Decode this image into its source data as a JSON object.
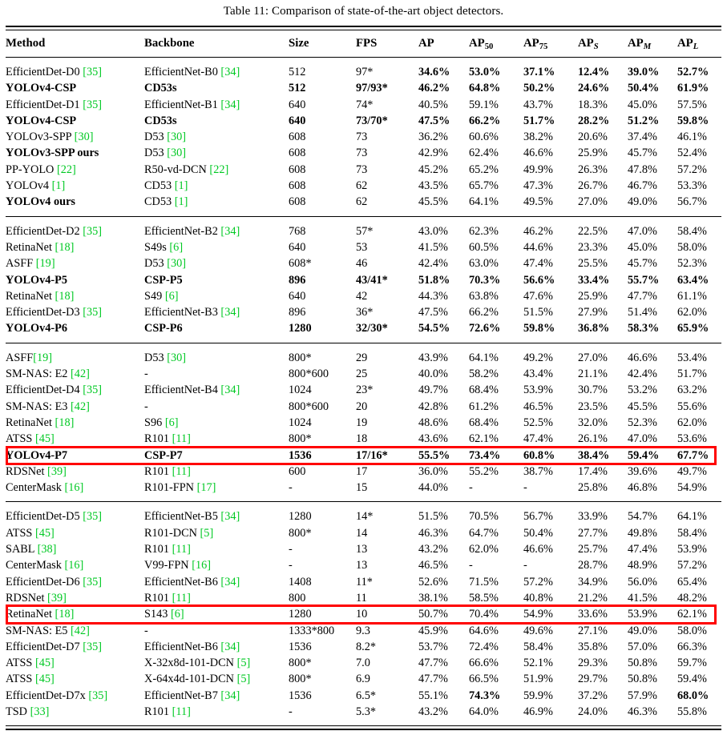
{
  "caption": "Table 11: Comparison of state-of-the-art object detectors.",
  "colors": {
    "citation_green": "#00C923",
    "highlight_red": "#FF0000"
  },
  "columns": [
    {
      "key": "method",
      "label": "Method"
    },
    {
      "key": "backbone",
      "label": "Backbone"
    },
    {
      "key": "size",
      "label": "Size"
    },
    {
      "key": "fps",
      "label": "FPS"
    },
    {
      "key": "ap",
      "label": "AP"
    },
    {
      "key": "ap50",
      "label": "AP",
      "sub": "50"
    },
    {
      "key": "ap75",
      "label": "AP",
      "sub": "75"
    },
    {
      "key": "aps",
      "label": "AP",
      "sub": "S"
    },
    {
      "key": "apm",
      "label": "AP",
      "sub": "M"
    },
    {
      "key": "apl",
      "label": "AP",
      "sub": "L"
    }
  ],
  "sections": [
    {
      "rows": [
        {
          "bold": false,
          "method": "EfficientDet-D0",
          "method_cite": "35",
          "backbone": "EfficientNet-B0",
          "backbone_cite": "34",
          "size": "512",
          "fps": "97*",
          "ap": "34.6%",
          "ap50": "53.0%",
          "ap75": "37.1%",
          "aps": "12.4%",
          "apm": "39.0%",
          "apl": "52.7%",
          "bold_nums": true
        },
        {
          "bold": true,
          "method": "YOLOv4-CSP",
          "method_cite": "",
          "backbone": "CD53s",
          "backbone_cite": "",
          "size": "512",
          "fps": "97/93*",
          "ap": "46.2%",
          "ap50": "64.8%",
          "ap75": "50.2%",
          "aps": "24.6%",
          "apm": "50.4%",
          "apl": "61.9%",
          "bold_nums": true
        },
        {
          "bold": false,
          "method": "EfficientDet-D1",
          "method_cite": "35",
          "backbone": "EfficientNet-B1",
          "backbone_cite": "34",
          "size": "640",
          "fps": "74*",
          "ap": "40.5%",
          "ap50": "59.1%",
          "ap75": "43.7%",
          "aps": "18.3%",
          "apm": "45.0%",
          "apl": "57.5%",
          "bold_nums": false
        },
        {
          "bold": true,
          "method": "YOLOv4-CSP",
          "method_cite": "",
          "backbone": "CD53s",
          "backbone_cite": "",
          "size": "640",
          "fps": "73/70*",
          "ap": "47.5%",
          "ap50": "66.2%",
          "ap75": "51.7%",
          "aps": "28.2%",
          "apm": "51.2%",
          "apl": "59.8%",
          "bold_nums": true
        },
        {
          "bold": false,
          "method": "YOLOv3-SPP",
          "method_cite": "30",
          "backbone": "D53",
          "backbone_cite": "30",
          "size": "608",
          "fps": "73",
          "ap": "36.2%",
          "ap50": "60.6%",
          "ap75": "38.2%",
          "aps": "20.6%",
          "apm": "37.4%",
          "apl": "46.1%",
          "bold_nums": false
        },
        {
          "bold": true,
          "method": "YOLOv3-SPP ours",
          "method_cite": "",
          "backbone": "D53",
          "backbone_cite": "30",
          "size": "608",
          "fps": "73",
          "ap": "42.9%",
          "ap50": "62.4%",
          "ap75": "46.6%",
          "aps": "25.9%",
          "apm": "45.7%",
          "apl": "52.4%",
          "bold_nums": false,
          "bold_method_only": true
        },
        {
          "bold": false,
          "method": "PP-YOLO",
          "method_cite": "22",
          "backbone": "R50-vd-DCN",
          "backbone_cite": "22",
          "size": "608",
          "fps": "73",
          "ap": "45.2%",
          "ap50": "65.2%",
          "ap75": "49.9%",
          "aps": "26.3%",
          "apm": "47.8%",
          "apl": "57.2%",
          "bold_nums": false
        },
        {
          "bold": false,
          "method": "YOLOv4",
          "method_cite": "1",
          "backbone": "CD53",
          "backbone_cite": "1",
          "size": "608",
          "fps": "62",
          "ap": "43.5%",
          "ap50": "65.7%",
          "ap75": "47.3%",
          "aps": "26.7%",
          "apm": "46.7%",
          "apl": "53.3%",
          "bold_nums": false
        },
        {
          "bold": true,
          "method": "YOLOv4 ours",
          "method_cite": "",
          "backbone": "CD53",
          "backbone_cite": "1",
          "size": "608",
          "fps": "62",
          "ap": "45.5%",
          "ap50": "64.1%",
          "ap75": "49.5%",
          "aps": "27.0%",
          "apm": "49.0%",
          "apl": "56.7%",
          "bold_nums": false,
          "bold_method_only": true
        }
      ]
    },
    {
      "rows": [
        {
          "bold": false,
          "method": "EfficientDet-D2",
          "method_cite": "35",
          "backbone": "EfficientNet-B2",
          "backbone_cite": "34",
          "size": "768",
          "fps": "57*",
          "ap": "43.0%",
          "ap50": "62.3%",
          "ap75": "46.2%",
          "aps": "22.5%",
          "apm": "47.0%",
          "apl": "58.4%",
          "bold_nums": false
        },
        {
          "bold": false,
          "method": "RetinaNet",
          "method_cite": "18",
          "backbone": "S49s",
          "backbone_cite": "6",
          "size": "640",
          "fps": "53",
          "ap": "41.5%",
          "ap50": "60.5%",
          "ap75": "44.6%",
          "aps": "23.3%",
          "apm": "45.0%",
          "apl": "58.0%",
          "bold_nums": false
        },
        {
          "bold": false,
          "method": "ASFF",
          "method_cite": "19",
          "backbone": "D53",
          "backbone_cite": "30",
          "size": "608*",
          "fps": "46",
          "ap": "42.4%",
          "ap50": "63.0%",
          "ap75": "47.4%",
          "aps": "25.5%",
          "apm": "45.7%",
          "apl": "52.3%",
          "bold_nums": false
        },
        {
          "bold": true,
          "method": "YOLOv4-P5",
          "method_cite": "",
          "backbone": "CSP-P5",
          "backbone_cite": "",
          "size": "896",
          "fps": "43/41*",
          "ap": "51.8%",
          "ap50": "70.3%",
          "ap75": "56.6%",
          "aps": "33.4%",
          "apm": "55.7%",
          "apl": "63.4%",
          "bold_nums": true
        },
        {
          "bold": false,
          "method": "RetinaNet",
          "method_cite": "18",
          "backbone": "S49",
          "backbone_cite": "6",
          "size": "640",
          "fps": "42",
          "ap": "44.3%",
          "ap50": "63.8%",
          "ap75": "47.6%",
          "aps": "25.9%",
          "apm": "47.7%",
          "apl": "61.1%",
          "bold_nums": false
        },
        {
          "bold": false,
          "method": "EfficientDet-D3",
          "method_cite": "35",
          "backbone": "EfficientNet-B3",
          "backbone_cite": "34",
          "size": "896",
          "fps": "36*",
          "ap": "47.5%",
          "ap50": "66.2%",
          "ap75": "51.5%",
          "aps": "27.9%",
          "apm": "51.4%",
          "apl": "62.0%",
          "bold_nums": false
        },
        {
          "bold": true,
          "method": "YOLOv4-P6",
          "method_cite": "",
          "backbone": "CSP-P6",
          "backbone_cite": "",
          "size": "1280",
          "fps": "32/30*",
          "ap": "54.5%",
          "ap50": "72.6%",
          "ap75": "59.8%",
          "aps": "36.8%",
          "apm": "58.3%",
          "apl": "65.9%",
          "bold_nums": true
        }
      ]
    },
    {
      "rows": [
        {
          "bold": false,
          "method": "ASFF",
          "method_cite": "19",
          "method_nospace": true,
          "backbone": "D53",
          "backbone_cite": "30",
          "size": "800*",
          "fps": "29",
          "ap": "43.9%",
          "ap50": "64.1%",
          "ap75": "49.2%",
          "aps": "27.0%",
          "apm": "46.6%",
          "apl": "53.4%",
          "bold_nums": false
        },
        {
          "bold": false,
          "method": "SM-NAS: E2",
          "method_cite": "42",
          "backbone": "-",
          "backbone_cite": "",
          "size": "800*600",
          "fps": "25",
          "ap": "40.0%",
          "ap50": "58.2%",
          "ap75": "43.4%",
          "aps": "21.1%",
          "apm": "42.4%",
          "apl": "51.7%",
          "bold_nums": false
        },
        {
          "bold": false,
          "method": "EfficientDet-D4",
          "method_cite": "35",
          "backbone": "EfficientNet-B4",
          "backbone_cite": "34",
          "size": "1024",
          "fps": "23*",
          "ap": "49.7%",
          "ap50": "68.4%",
          "ap75": "53.9%",
          "aps": "30.7%",
          "apm": "53.2%",
          "apl": "63.2%",
          "bold_nums": false
        },
        {
          "bold": false,
          "method": "SM-NAS: E3",
          "method_cite": "42",
          "backbone": "-",
          "backbone_cite": "",
          "size": "800*600",
          "fps": "20",
          "ap": "42.8%",
          "ap50": "61.2%",
          "ap75": "46.5%",
          "aps": "23.5%",
          "apm": "45.5%",
          "apl": "55.6%",
          "bold_nums": false
        },
        {
          "bold": false,
          "method": "RetinaNet",
          "method_cite": "18",
          "backbone": "S96",
          "backbone_cite": "6",
          "size": "1024",
          "fps": "19",
          "ap": "48.6%",
          "ap50": "68.4%",
          "ap75": "52.5%",
          "aps": "32.0%",
          "apm": "52.3%",
          "apl": "62.0%",
          "bold_nums": false
        },
        {
          "bold": false,
          "method": "ATSS",
          "method_cite": "45",
          "backbone": "R101",
          "backbone_cite": "11",
          "size": "800*",
          "fps": "18",
          "ap": "43.6%",
          "ap50": "62.1%",
          "ap75": "47.4%",
          "aps": "26.1%",
          "apm": "47.0%",
          "apl": "53.6%",
          "bold_nums": false
        },
        {
          "bold": true,
          "method": "YOLOv4-P7",
          "method_cite": "",
          "backbone": "CSP-P7",
          "backbone_cite": "",
          "size": "1536",
          "fps": "17/16*",
          "ap": "55.5%",
          "ap50": "73.4%",
          "ap75": "60.8%",
          "aps": "38.4%",
          "apm": "59.4%",
          "apl": "67.7%",
          "bold_nums": true,
          "highlight": true
        },
        {
          "bold": false,
          "method": "RDSNet",
          "method_cite": "39",
          "backbone": "R101",
          "backbone_cite": "11",
          "size": "600",
          "fps": "17",
          "ap": "36.0%",
          "ap50": "55.2%",
          "ap75": "38.7%",
          "aps": "17.4%",
          "apm": "39.6%",
          "apl": "49.7%",
          "bold_nums": false
        },
        {
          "bold": false,
          "method": "CenterMask",
          "method_cite": "16",
          "backbone": "R101-FPN",
          "backbone_cite": "17",
          "size": "-",
          "fps": "15",
          "ap": "44.0%",
          "ap50": "-",
          "ap75": "-",
          "aps": "25.8%",
          "apm": "46.8%",
          "apl": "54.9%",
          "bold_nums": false
        }
      ]
    },
    {
      "rows": [
        {
          "bold": false,
          "method": "EfficientDet-D5",
          "method_cite": "35",
          "backbone": "EfficientNet-B5",
          "backbone_cite": "34",
          "size": "1280",
          "fps": "14*",
          "ap": "51.5%",
          "ap50": "70.5%",
          "ap75": "56.7%",
          "aps": "33.9%",
          "apm": "54.7%",
          "apl": "64.1%",
          "bold_nums": false
        },
        {
          "bold": false,
          "method": "ATSS",
          "method_cite": "45",
          "backbone": "R101-DCN",
          "backbone_cite": "5",
          "size": "800*",
          "fps": "14",
          "ap": "46.3%",
          "ap50": "64.7%",
          "ap75": "50.4%",
          "aps": "27.7%",
          "apm": "49.8%",
          "apl": "58.4%",
          "bold_nums": false
        },
        {
          "bold": false,
          "method": "SABL",
          "method_cite": "38",
          "backbone": "R101",
          "backbone_cite": "11",
          "size": "-",
          "fps": "13",
          "ap": "43.2%",
          "ap50": "62.0%",
          "ap75": "46.6%",
          "aps": "25.7%",
          "apm": "47.4%",
          "apl": "53.9%",
          "bold_nums": false
        },
        {
          "bold": false,
          "method": "CenterMask",
          "method_cite": "16",
          "backbone": "V99-FPN",
          "backbone_cite": "16",
          "size": "-",
          "fps": "13",
          "ap": "46.5%",
          "ap50": "-",
          "ap75": "-",
          "aps": "28.7%",
          "apm": "48.9%",
          "apl": "57.2%",
          "bold_nums": false
        },
        {
          "bold": false,
          "method": "EfficientDet-D6",
          "method_cite": "35",
          "backbone": "EfficientNet-B6",
          "backbone_cite": "34",
          "size": "1408",
          "fps": "11*",
          "ap": "52.6%",
          "ap50": "71.5%",
          "ap75": "57.2%",
          "aps": "34.9%",
          "apm": "56.0%",
          "apl": "65.4%",
          "bold_nums": false
        },
        {
          "bold": false,
          "method": "RDSNet",
          "method_cite": "39",
          "backbone": "R101",
          "backbone_cite": "11",
          "size": "800",
          "fps": "11",
          "ap": "38.1%",
          "ap50": "58.5%",
          "ap75": "40.8%",
          "aps": "21.2%",
          "apm": "41.5%",
          "apl": "48.2%",
          "bold_nums": false
        },
        {
          "bold": false,
          "method": "RetinaNet",
          "method_cite": "18",
          "backbone": "S143",
          "backbone_cite": "6",
          "size": "1280",
          "fps": "10",
          "ap": "50.7%",
          "ap50": "70.4%",
          "ap75": "54.9%",
          "aps": "33.6%",
          "apm": "53.9%",
          "apl": "62.1%",
          "bold_nums": false,
          "highlight": true
        },
        {
          "bold": false,
          "method": "SM-NAS: E5",
          "method_cite": "42",
          "backbone": "-",
          "backbone_cite": "",
          "size": "1333*800",
          "fps": "9.3",
          "ap": "45.9%",
          "ap50": "64.6%",
          "ap75": "49.6%",
          "aps": "27.1%",
          "apm": "49.0%",
          "apl": "58.0%",
          "bold_nums": false
        },
        {
          "bold": false,
          "method": "EfficientDet-D7",
          "method_cite": "35",
          "backbone": "EfficientNet-B6",
          "backbone_cite": "34",
          "size": "1536",
          "fps": "8.2*",
          "ap": "53.7%",
          "ap50": "72.4%",
          "ap75": "58.4%",
          "aps": "35.8%",
          "apm": "57.0%",
          "apl": "66.3%",
          "bold_nums": false
        },
        {
          "bold": false,
          "method": "ATSS",
          "method_cite": "45",
          "backbone": "X-32x8d-101-DCN",
          "backbone_cite": "5",
          "size": "800*",
          "fps": "7.0",
          "ap": "47.7%",
          "ap50": "66.6%",
          "ap75": "52.1%",
          "aps": "29.3%",
          "apm": "50.8%",
          "apl": "59.7%",
          "bold_nums": false
        },
        {
          "bold": false,
          "method": "ATSS",
          "method_cite": "45",
          "backbone": "X-64x4d-101-DCN",
          "backbone_cite": "5",
          "size": "800*",
          "fps": "6.9",
          "ap": "47.7%",
          "ap50": "66.5%",
          "ap75": "51.9%",
          "aps": "29.7%",
          "apm": "50.8%",
          "apl": "59.4%",
          "bold_nums": false
        },
        {
          "bold": false,
          "method": "EfficientDet-D7x",
          "method_cite": "35",
          "backbone": "EfficientNet-B7",
          "backbone_cite": "34",
          "size": "1536",
          "fps": "6.5*",
          "ap": "55.1%",
          "ap50": "74.3%",
          "ap75": "59.9%",
          "aps": "37.2%",
          "apm": "57.9%",
          "apl": "68.0%",
          "bold_nums": false,
          "bold_cells": [
            "ap50",
            "apl"
          ]
        },
        {
          "bold": false,
          "method": "TSD",
          "method_cite": "33",
          "backbone": "R101",
          "backbone_cite": "11",
          "size": "-",
          "fps": "5.3*",
          "ap": "43.2%",
          "ap50": "64.0%",
          "ap75": "46.9%",
          "aps": "24.0%",
          "apm": "46.3%",
          "apl": "55.8%",
          "bold_nums": false
        }
      ]
    }
  ]
}
